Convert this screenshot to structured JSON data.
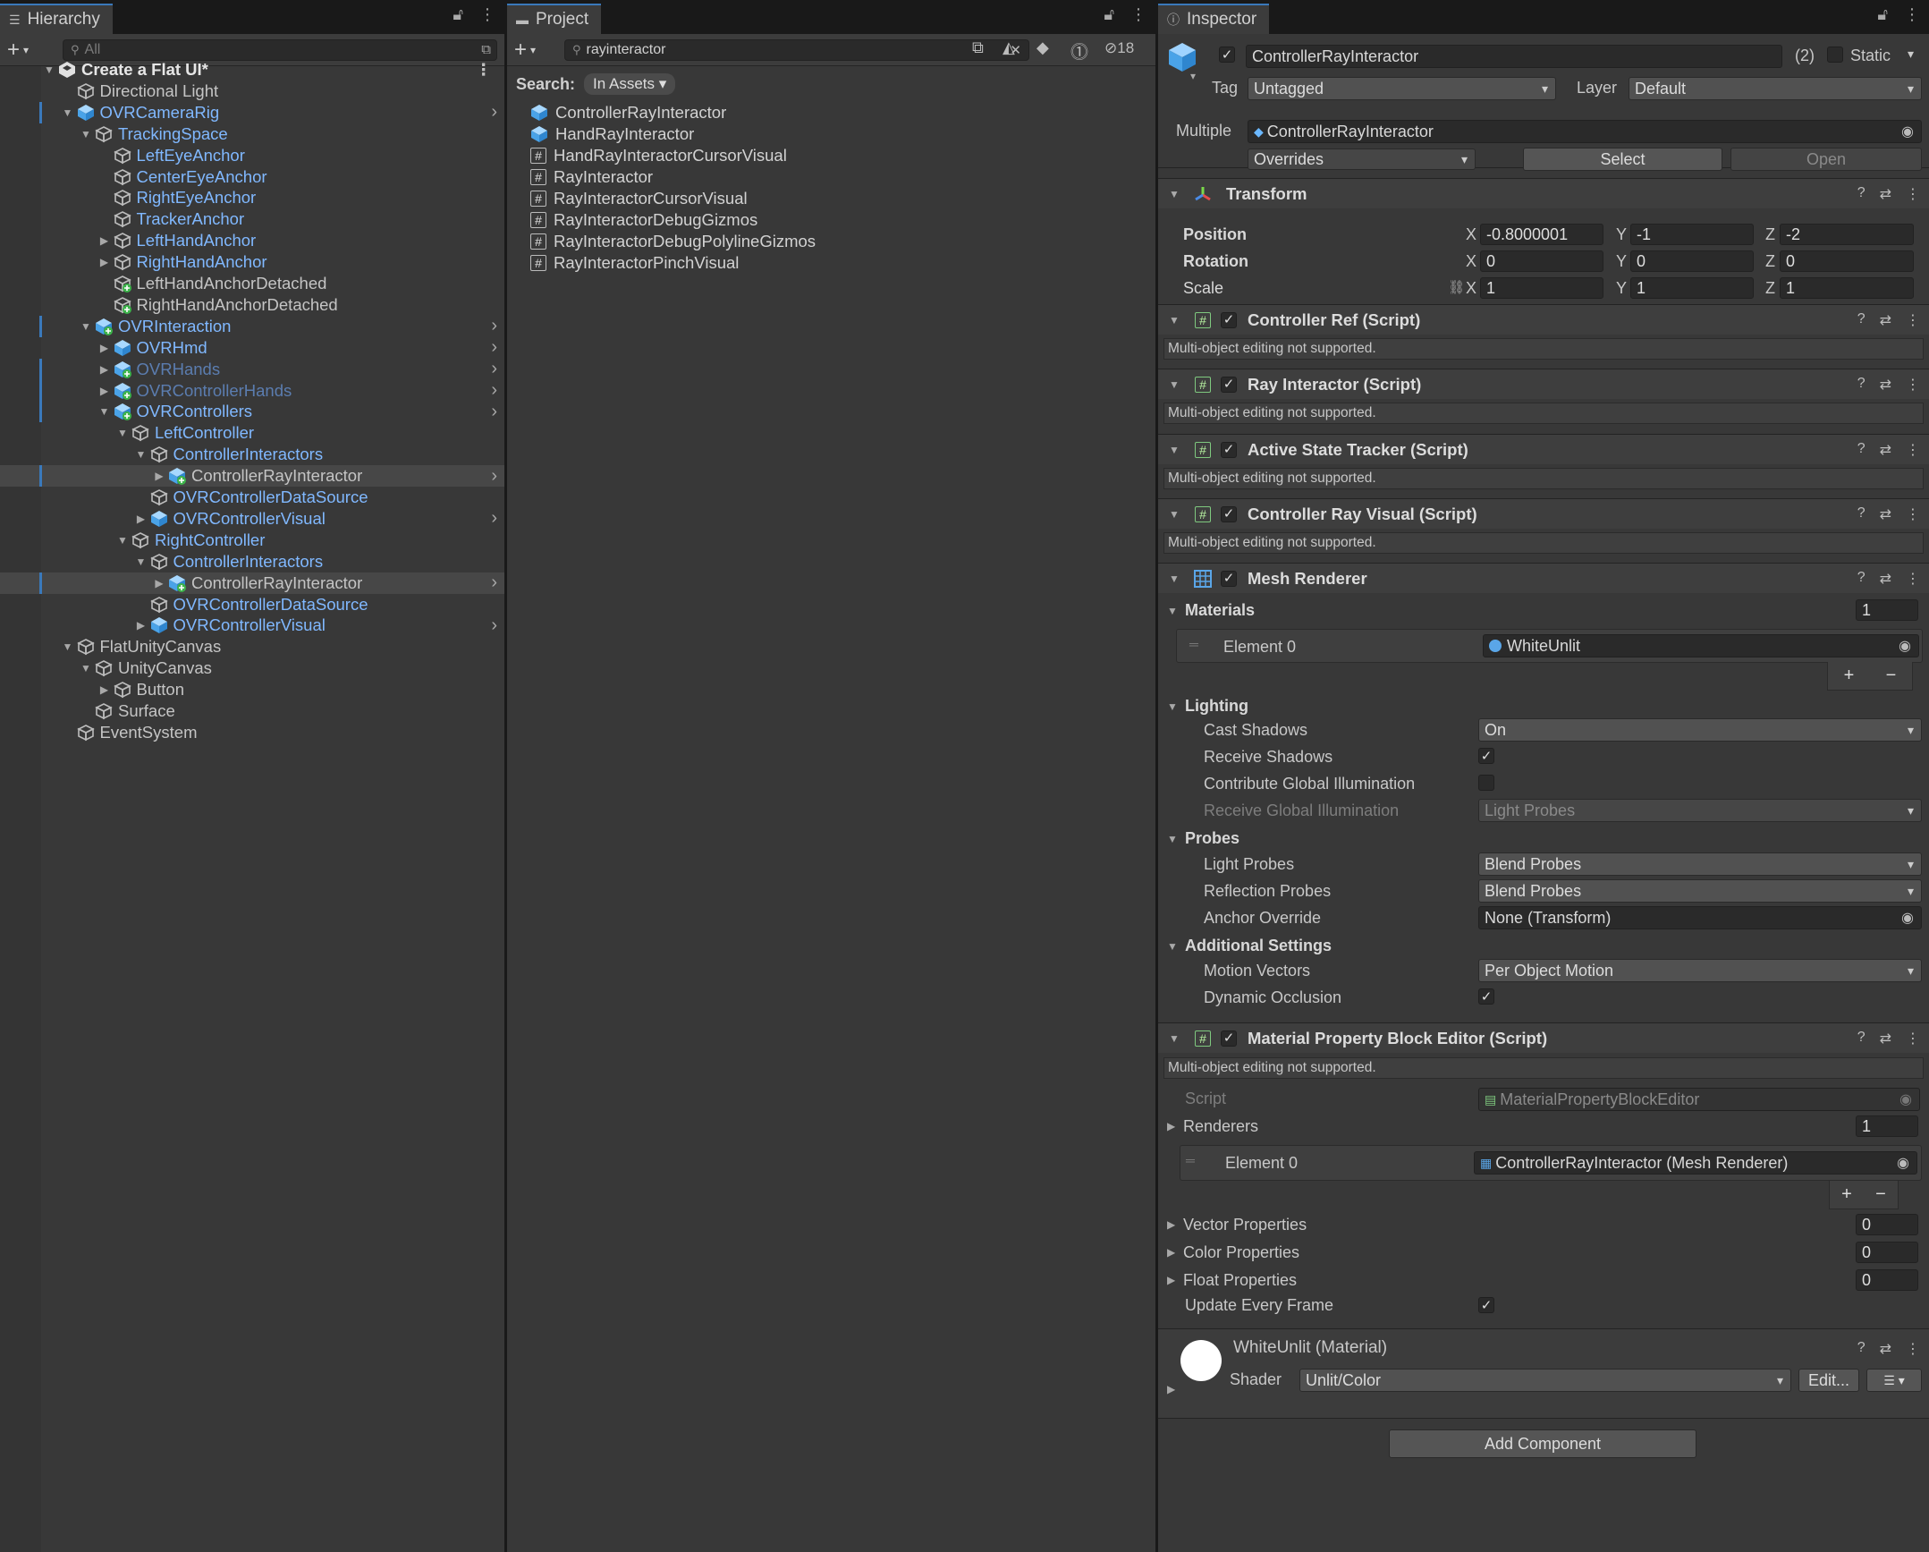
{
  "hierarchy": {
    "tab": "Hierarchy",
    "search_placeholder": "All",
    "rows": [
      {
        "label": "Create a Flat UI*",
        "indent": 0,
        "arrow": "down",
        "icon": "unity-scene-icon",
        "style": "bold"
      },
      {
        "label": "Directional Light",
        "indent": 1,
        "arrow": "",
        "icon": "gameobject-icon",
        "style": ""
      },
      {
        "label": "OVRCameraRig",
        "indent": 1,
        "arrow": "down",
        "icon": "prefab-icon",
        "style": "blue",
        "chev": true,
        "bar": true
      },
      {
        "label": "TrackingSpace",
        "indent": 2,
        "arrow": "down",
        "icon": "gameobject-icon",
        "style": "blue"
      },
      {
        "label": "LeftEyeAnchor",
        "indent": 3,
        "arrow": "",
        "icon": "gameobject-icon",
        "style": "blue"
      },
      {
        "label": "CenterEyeAnchor",
        "indent": 3,
        "arrow": "",
        "icon": "gameobject-icon",
        "style": "blue"
      },
      {
        "label": "RightEyeAnchor",
        "indent": 3,
        "arrow": "",
        "icon": "gameobject-icon",
        "style": "blue"
      },
      {
        "label": "TrackerAnchor",
        "indent": 3,
        "arrow": "",
        "icon": "gameobject-icon",
        "style": "blue"
      },
      {
        "label": "LeftHandAnchor",
        "indent": 3,
        "arrow": "right",
        "icon": "gameobject-icon",
        "style": "blue"
      },
      {
        "label": "RightHandAnchor",
        "indent": 3,
        "arrow": "right",
        "icon": "gameobject-icon",
        "style": "blue"
      },
      {
        "label": "LeftHandAnchorDetached",
        "indent": 3,
        "arrow": "",
        "icon": "gameobject-added-icon",
        "style": ""
      },
      {
        "label": "RightHandAnchorDetached",
        "indent": 3,
        "arrow": "",
        "icon": "gameobject-added-icon",
        "style": ""
      },
      {
        "label": "OVRInteraction",
        "indent": 2,
        "arrow": "down",
        "icon": "prefab-added-icon",
        "style": "blue",
        "chev": true,
        "bar": true
      },
      {
        "label": "OVRHmd",
        "indent": 3,
        "arrow": "right",
        "icon": "prefab-icon",
        "style": "blue",
        "chev": true
      },
      {
        "label": "OVRHands",
        "indent": 3,
        "arrow": "right",
        "icon": "prefab-added-icon",
        "style": "dim",
        "chev": true,
        "bar": true
      },
      {
        "label": "OVRControllerHands",
        "indent": 3,
        "arrow": "right",
        "icon": "prefab-added-icon",
        "style": "dim",
        "chev": true,
        "bar": true
      },
      {
        "label": "OVRControllers",
        "indent": 3,
        "arrow": "down",
        "icon": "prefab-added-icon",
        "style": "blue",
        "chev": true,
        "bar": true
      },
      {
        "label": "LeftController",
        "indent": 4,
        "arrow": "down",
        "icon": "gameobject-icon",
        "style": "blue"
      },
      {
        "label": "ControllerInteractors",
        "indent": 5,
        "arrow": "down",
        "icon": "gameobject-icon",
        "style": "blue"
      },
      {
        "label": "ControllerRayInteractor",
        "indent": 6,
        "arrow": "right",
        "icon": "prefab-added-icon",
        "style": "",
        "chev": true,
        "sel": true,
        "bar": true
      },
      {
        "label": "OVRControllerDataSource",
        "indent": 5,
        "arrow": "",
        "icon": "gameobject-icon",
        "style": "blue"
      },
      {
        "label": "OVRControllerVisual",
        "indent": 5,
        "arrow": "right",
        "icon": "prefab-icon",
        "style": "blue",
        "chev": true
      },
      {
        "label": "RightController",
        "indent": 4,
        "arrow": "down",
        "icon": "gameobject-icon",
        "style": "blue"
      },
      {
        "label": "ControllerInteractors",
        "indent": 5,
        "arrow": "down",
        "icon": "gameobject-icon",
        "style": "blue"
      },
      {
        "label": "ControllerRayInteractor",
        "indent": 6,
        "arrow": "right",
        "icon": "prefab-added-icon",
        "style": "",
        "chev": true,
        "sel": true,
        "bar": true
      },
      {
        "label": "OVRControllerDataSource",
        "indent": 5,
        "arrow": "",
        "icon": "gameobject-icon",
        "style": "blue"
      },
      {
        "label": "OVRControllerVisual",
        "indent": 5,
        "arrow": "right",
        "icon": "prefab-icon",
        "style": "blue",
        "chev": true
      },
      {
        "label": "FlatUnityCanvas",
        "indent": 1,
        "arrow": "down",
        "icon": "gameobject-icon",
        "style": ""
      },
      {
        "label": "UnityCanvas",
        "indent": 2,
        "arrow": "down",
        "icon": "gameobject-icon",
        "style": ""
      },
      {
        "label": "Button",
        "indent": 3,
        "arrow": "right",
        "icon": "gameobject-icon",
        "style": ""
      },
      {
        "label": "Surface",
        "indent": 2,
        "arrow": "",
        "icon": "gameobject-icon",
        "style": ""
      },
      {
        "label": "EventSystem",
        "indent": 1,
        "arrow": "",
        "icon": "gameobject-icon",
        "style": ""
      }
    ]
  },
  "project": {
    "tab": "Project",
    "search_value": "rayinteractor",
    "hidden_count": "18",
    "search_label": "Search:",
    "scope": "In Assets",
    "results": [
      {
        "label": "ControllerRayInteractor",
        "icon": "prefab-icon"
      },
      {
        "label": "HandRayInteractor",
        "icon": "prefab-icon"
      },
      {
        "label": "HandRayInteractorCursorVisual",
        "icon": "script-icon"
      },
      {
        "label": "RayInteractor",
        "icon": "script-icon"
      },
      {
        "label": "RayInteractorCursorVisual",
        "icon": "script-icon"
      },
      {
        "label": "RayInteractorDebugGizmos",
        "icon": "script-icon"
      },
      {
        "label": "RayInteractorDebugPolylineGizmos",
        "icon": "script-icon"
      },
      {
        "label": "RayInteractorPinchVisual",
        "icon": "script-icon"
      }
    ]
  },
  "inspector": {
    "tab": "Inspector",
    "object_name": "ControllerRayInteractor",
    "count": "(2)",
    "static_label": "Static",
    "tag_label": "Tag",
    "tag_value": "Untagged",
    "layer_label": "Layer",
    "layer_value": "Default",
    "multiple_label": "Multiple",
    "multiple_value": "ControllerRayInteractor",
    "overrides": "Overrides",
    "select": "Select",
    "open": "Open",
    "transform": {
      "title": "Transform",
      "position_label": "Position",
      "rotation_label": "Rotation",
      "scale_label": "Scale",
      "position": {
        "x": "-0.8000001",
        "y": "-1",
        "z": "-2"
      },
      "rotation": {
        "x": "0",
        "y": "0",
        "z": "0"
      },
      "scale": {
        "x": "1",
        "y": "1",
        "z": "1"
      }
    },
    "axis": {
      "x": "X",
      "y": "Y",
      "z": "Z"
    },
    "note": "Multi-object editing not supported.",
    "comp_controller_ref": "Controller Ref (Script)",
    "comp_ray_interactor": "Ray Interactor (Script)",
    "comp_active_state": "Active State Tracker (Script)",
    "comp_ray_visual": "Controller Ray Visual (Script)",
    "mesh_renderer": {
      "title": "Mesh Renderer",
      "materials_label": "Materials",
      "materials_count": "1",
      "element0_label": "Element 0",
      "element0_value": "WhiteUnlit",
      "lighting_label": "Lighting",
      "cast_shadows_label": "Cast Shadows",
      "cast_shadows_value": "On",
      "receive_shadows_label": "Receive Shadows",
      "contribute_gi_label": "Contribute Global Illumination",
      "receive_gi_label": "Receive Global Illumination",
      "receive_gi_value": "Light Probes",
      "probes_label": "Probes",
      "light_probes_label": "Light Probes",
      "light_probes_value": "Blend Probes",
      "reflection_probes_label": "Reflection Probes",
      "reflection_probes_value": "Blend Probes",
      "anchor_override_label": "Anchor Override",
      "anchor_override_value": "None (Transform)",
      "additional_label": "Additional Settings",
      "motion_vectors_label": "Motion Vectors",
      "motion_vectors_value": "Per Object Motion",
      "dynamic_occlusion_label": "Dynamic Occlusion"
    },
    "mpb": {
      "title": "Material Property Block Editor (Script)",
      "script_label": "Script",
      "script_value": "MaterialPropertyBlockEditor",
      "renderers_label": "Renderers",
      "renderers_count": "1",
      "element0_label": "Element 0",
      "element0_value": "ControllerRayInteractor (Mesh Renderer)",
      "vector_label": "Vector Properties",
      "vector_value": "0",
      "color_label": "Color Properties",
      "color_value": "0",
      "float_label": "Float Properties",
      "float_value": "0",
      "update_label": "Update Every Frame"
    },
    "material": {
      "title": "WhiteUnlit (Material)",
      "shader_label": "Shader",
      "shader_value": "Unlit/Color",
      "edit": "Edit..."
    },
    "add_component": "Add Component"
  },
  "colors": {
    "accent": "#3a79bb",
    "prefab_blue": "#80b8ff",
    "panel": "#383838"
  }
}
